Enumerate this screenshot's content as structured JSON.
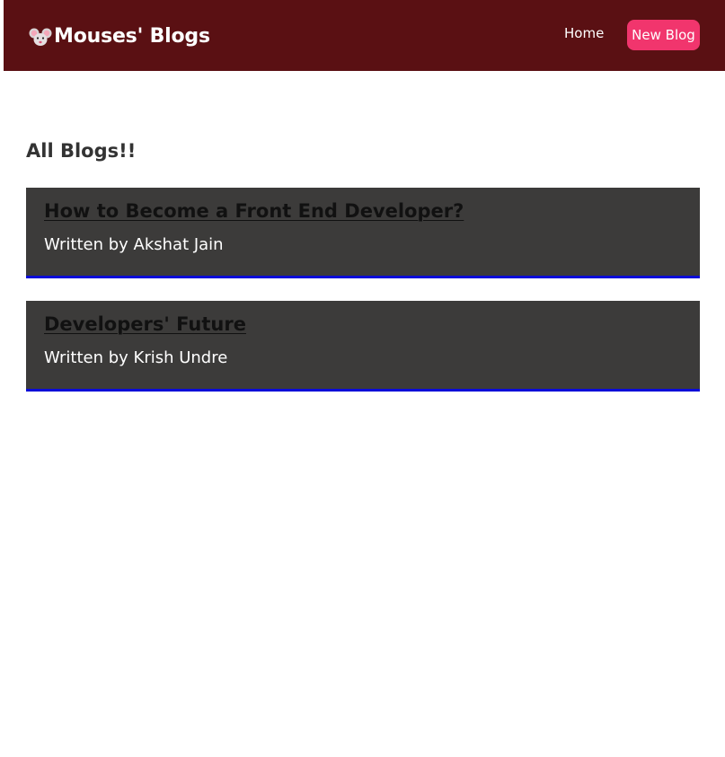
{
  "navbar": {
    "brand": "Mouses' Blogs",
    "brand_icon": "mouse-face-icon",
    "links": {
      "home": "Home",
      "new_blog": "New Blog"
    }
  },
  "colors": {
    "navbar_bg": "#5a1013",
    "new_blog_button": "#f1356d",
    "card_bg": "#3c3b3a",
    "card_border": "#0a0bd8"
  },
  "main": {
    "heading": "All Blogs!!",
    "blogs": [
      {
        "title": "How to Become a Front End Developer?",
        "author_line": "Written by Akshat Jain"
      },
      {
        "title": "Developers' Future",
        "author_line": "Written by Krish Undre"
      }
    ]
  }
}
